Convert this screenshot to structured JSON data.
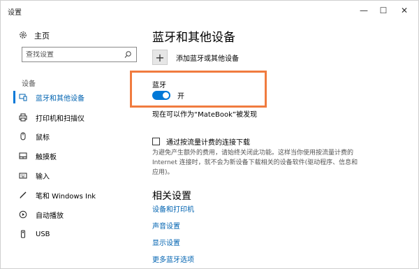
{
  "window": {
    "title": "设置",
    "controls": {
      "minimize": "—",
      "maximize": "☐",
      "close": "✕"
    }
  },
  "sidebar": {
    "home_label": "主页",
    "search_placeholder": "查找设置",
    "section_label": "设备",
    "items": [
      {
        "label": "蓝牙和其他设备",
        "icon": "bluetooth-devices-icon",
        "active": true
      },
      {
        "label": "打印机和扫描仪",
        "icon": "printer-icon",
        "active": false
      },
      {
        "label": "鼠标",
        "icon": "mouse-icon",
        "active": false
      },
      {
        "label": "触摸板",
        "icon": "touchpad-icon",
        "active": false
      },
      {
        "label": "输入",
        "icon": "keyboard-icon",
        "active": false
      },
      {
        "label": "笔和 Windows Ink",
        "icon": "pen-icon",
        "active": false
      },
      {
        "label": "自动播放",
        "icon": "autoplay-icon",
        "active": false
      },
      {
        "label": "USB",
        "icon": "usb-icon",
        "active": false
      }
    ]
  },
  "main": {
    "title": "蓝牙和其他设备",
    "add_device_label": "添加蓝牙或其他设备",
    "bluetooth": {
      "label": "蓝牙",
      "state_label": "开",
      "on": true,
      "discoverable_text": "现在可以作为“MateBook”被发现"
    },
    "metered": {
      "label": "通过按流量计费的连接下载",
      "checked": false,
      "description": "为避免产生额外的费用，请始终关闭此功能。这样当你使用按流量计费的 Internet 连接时，就不会为新设备下载相关的设备软件(驱动程序、信息和应用)。"
    },
    "related": {
      "title": "相关设置",
      "links": [
        "设备和打印机",
        "声音设置",
        "显示设置",
        "更多蓝牙选项"
      ]
    }
  },
  "colors": {
    "accent": "#0078d7",
    "link": "#0063b1",
    "highlight_border": "#f07b3f"
  }
}
